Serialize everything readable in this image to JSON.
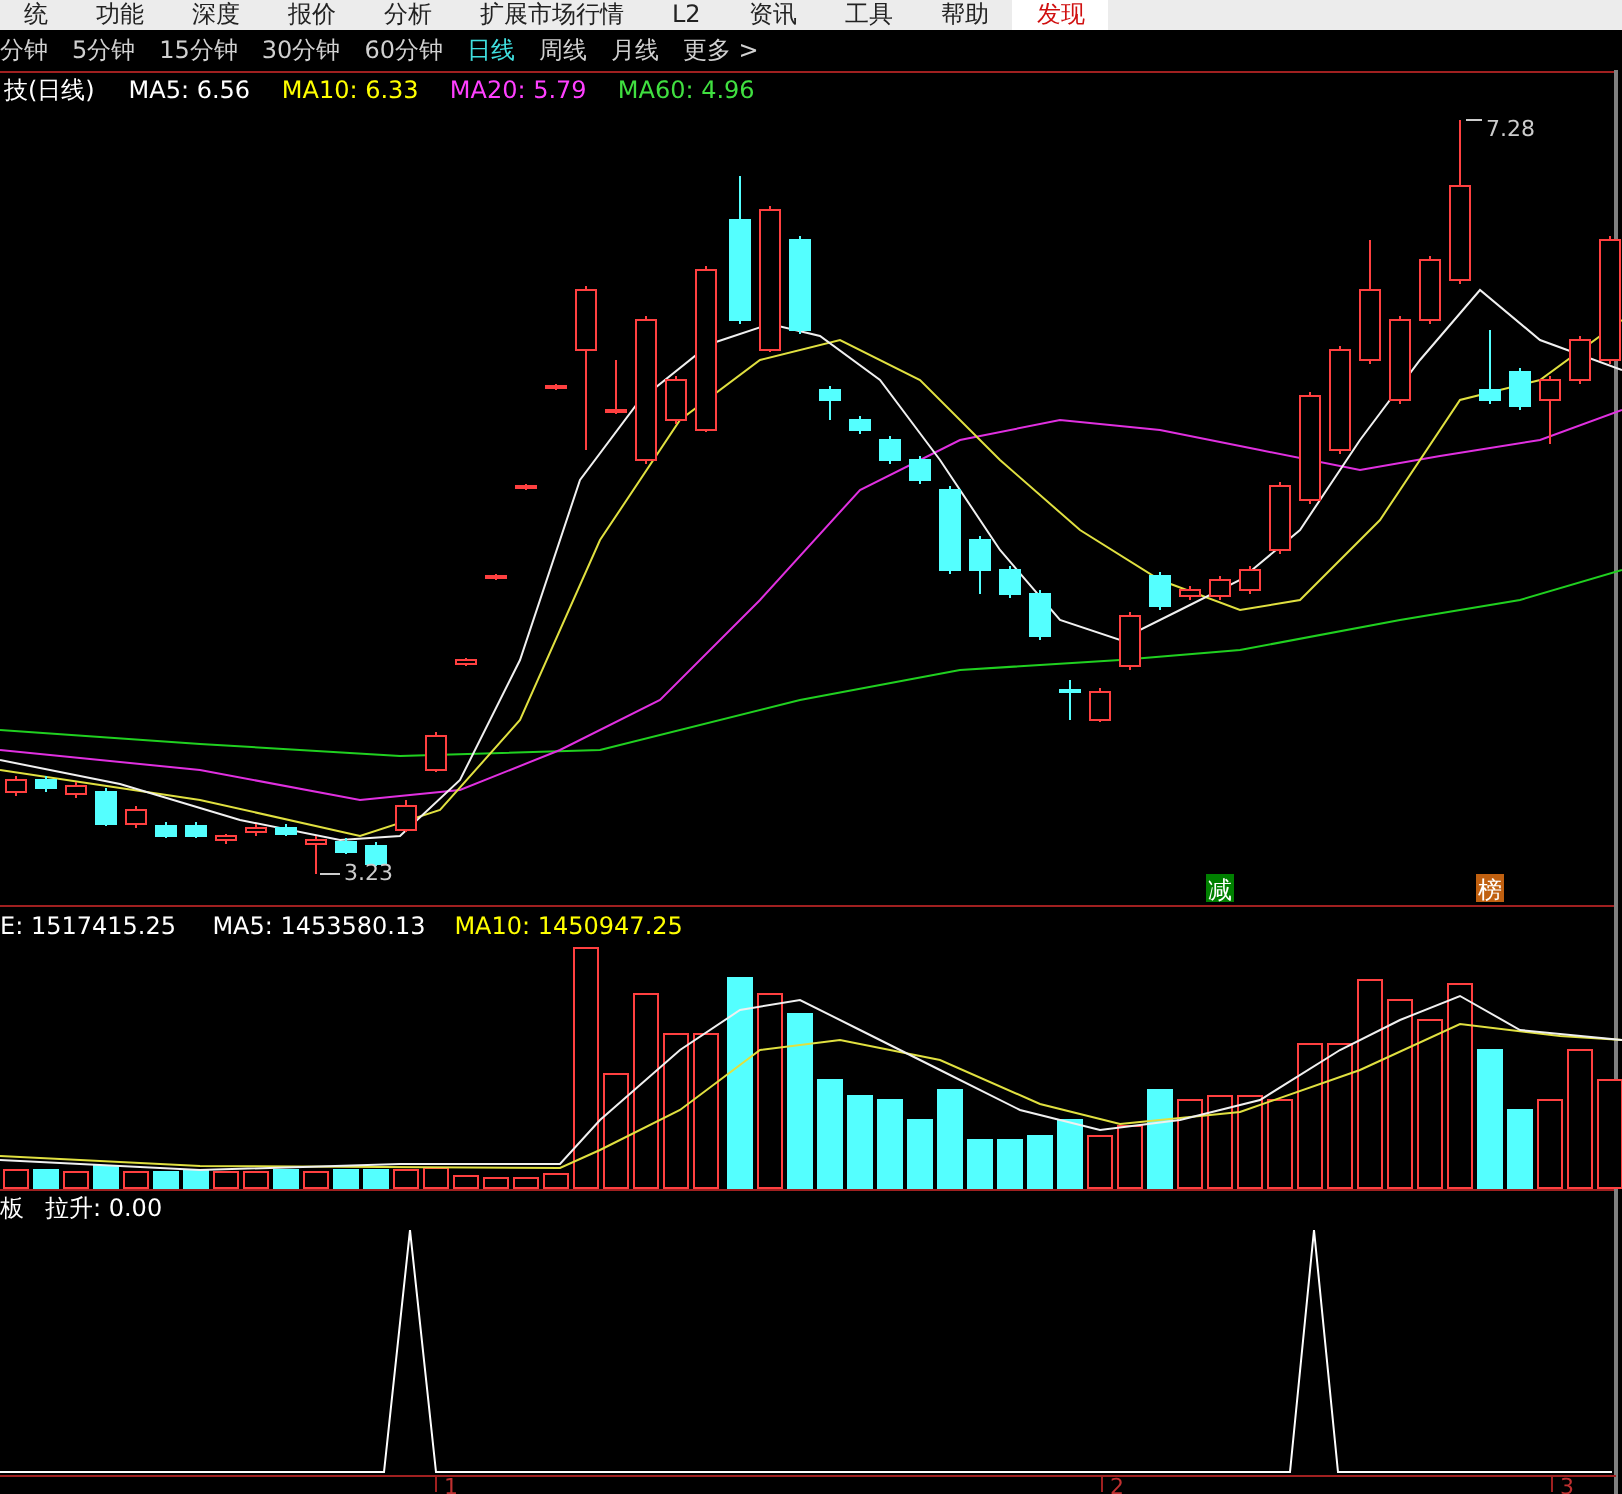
{
  "menu_bar": {
    "items": [
      {
        "label": "统",
        "selected": false
      },
      {
        "label": "功能",
        "selected": false
      },
      {
        "label": "深度",
        "selected": false
      },
      {
        "label": "报价",
        "selected": false
      },
      {
        "label": "分析",
        "selected": false
      },
      {
        "label": "扩展市场行情",
        "selected": false
      },
      {
        "label": "L2",
        "selected": false
      },
      {
        "label": "资讯",
        "selected": false
      },
      {
        "label": "工具",
        "selected": false
      },
      {
        "label": "帮助",
        "selected": false
      },
      {
        "label": "发现",
        "selected": true
      }
    ]
  },
  "period_tabs": [
    {
      "label": "分钟",
      "selected": false
    },
    {
      "label": "5分钟",
      "selected": false
    },
    {
      "label": "15分钟",
      "selected": false
    },
    {
      "label": "30分钟",
      "selected": false
    },
    {
      "label": "60分钟",
      "selected": false
    },
    {
      "label": "日线",
      "selected": true
    },
    {
      "label": "周线",
      "selected": false
    },
    {
      "label": "月线",
      "selected": false
    },
    {
      "label": "更多 >",
      "selected": false
    }
  ],
  "price_panel": {
    "legend": [
      {
        "text": "技(日线)",
        "color": "#ffffff"
      },
      {
        "text": "MA5: 6.56",
        "color": "#ffffff"
      },
      {
        "text": "MA10: 6.33",
        "color": "#ffff00"
      },
      {
        "text": "MA20: 5.79",
        "color": "#ff40ff"
      },
      {
        "text": "MA60: 4.96",
        "color": "#40e040"
      }
    ],
    "high_label": "7.28",
    "low_label": "3.23",
    "markers": [
      {
        "text": "减",
        "color": "#008000"
      },
      {
        "text": "榜",
        "color": "#c06010"
      }
    ]
  },
  "volume_panel": {
    "legend": [
      {
        "text": "E: 1517415.25",
        "color": "#ffffff"
      },
      {
        "text": "MA5: 1453580.13",
        "color": "#ffffff"
      },
      {
        "text": "MA10: 1450947.25",
        "color": "#ffff00"
      }
    ]
  },
  "indicator_panel": {
    "legend": [
      {
        "text": "板",
        "color": "#ffffff"
      },
      {
        "text": "拉升: 0.00",
        "color": "#ffffff"
      }
    ]
  },
  "x_axis": {
    "labels": [
      "1",
      "2",
      "3"
    ]
  }
}
